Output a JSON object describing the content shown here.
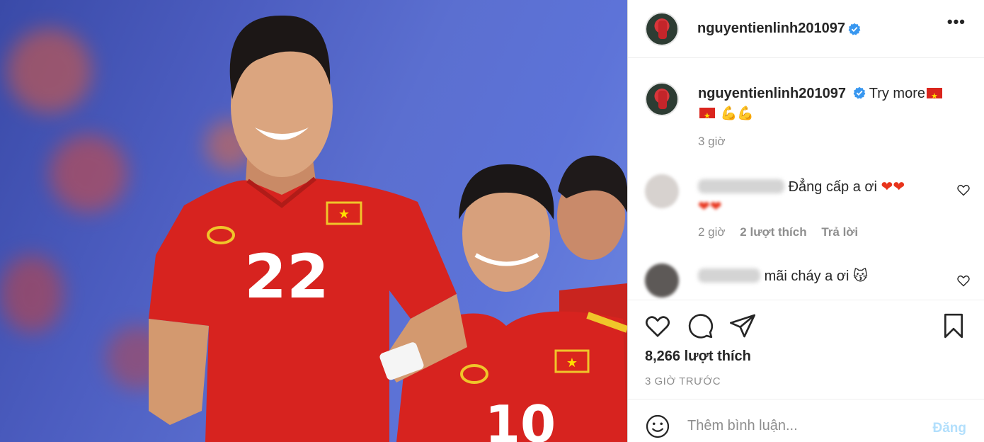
{
  "post": {
    "username": "nguyentienlinh201097",
    "more_icon": "more-dots-icon",
    "caption_text": "Try more",
    "caption_time": "3 giờ",
    "likes": "8,266 lượt thích",
    "posted_ago": "3 GIỜ TRƯỚC",
    "photo": {
      "jersey_number_main": "22",
      "jersey_number_back": "10",
      "colors": {
        "jersey": "#d7231f",
        "background": "#4c5dc0"
      }
    }
  },
  "comments": [
    {
      "text": "Đẳng cấp a ơi",
      "meta_time": "2 giờ",
      "meta_likes": "2 lượt thích",
      "meta_reply": "Trả lời"
    },
    {
      "text": "mãi cháy a ơi"
    }
  ],
  "add_comment": {
    "placeholder": "Thêm bình luận...",
    "post_label": "Đăng"
  },
  "icons": {
    "like": "heart-icon",
    "comment": "comment-icon",
    "share": "send-icon",
    "save": "bookmark-icon",
    "emoji": "smiley-icon"
  },
  "colors": {
    "verified": "#3897f0",
    "muted": "#8e8e8e",
    "post_disabled": "#b2dffc"
  }
}
